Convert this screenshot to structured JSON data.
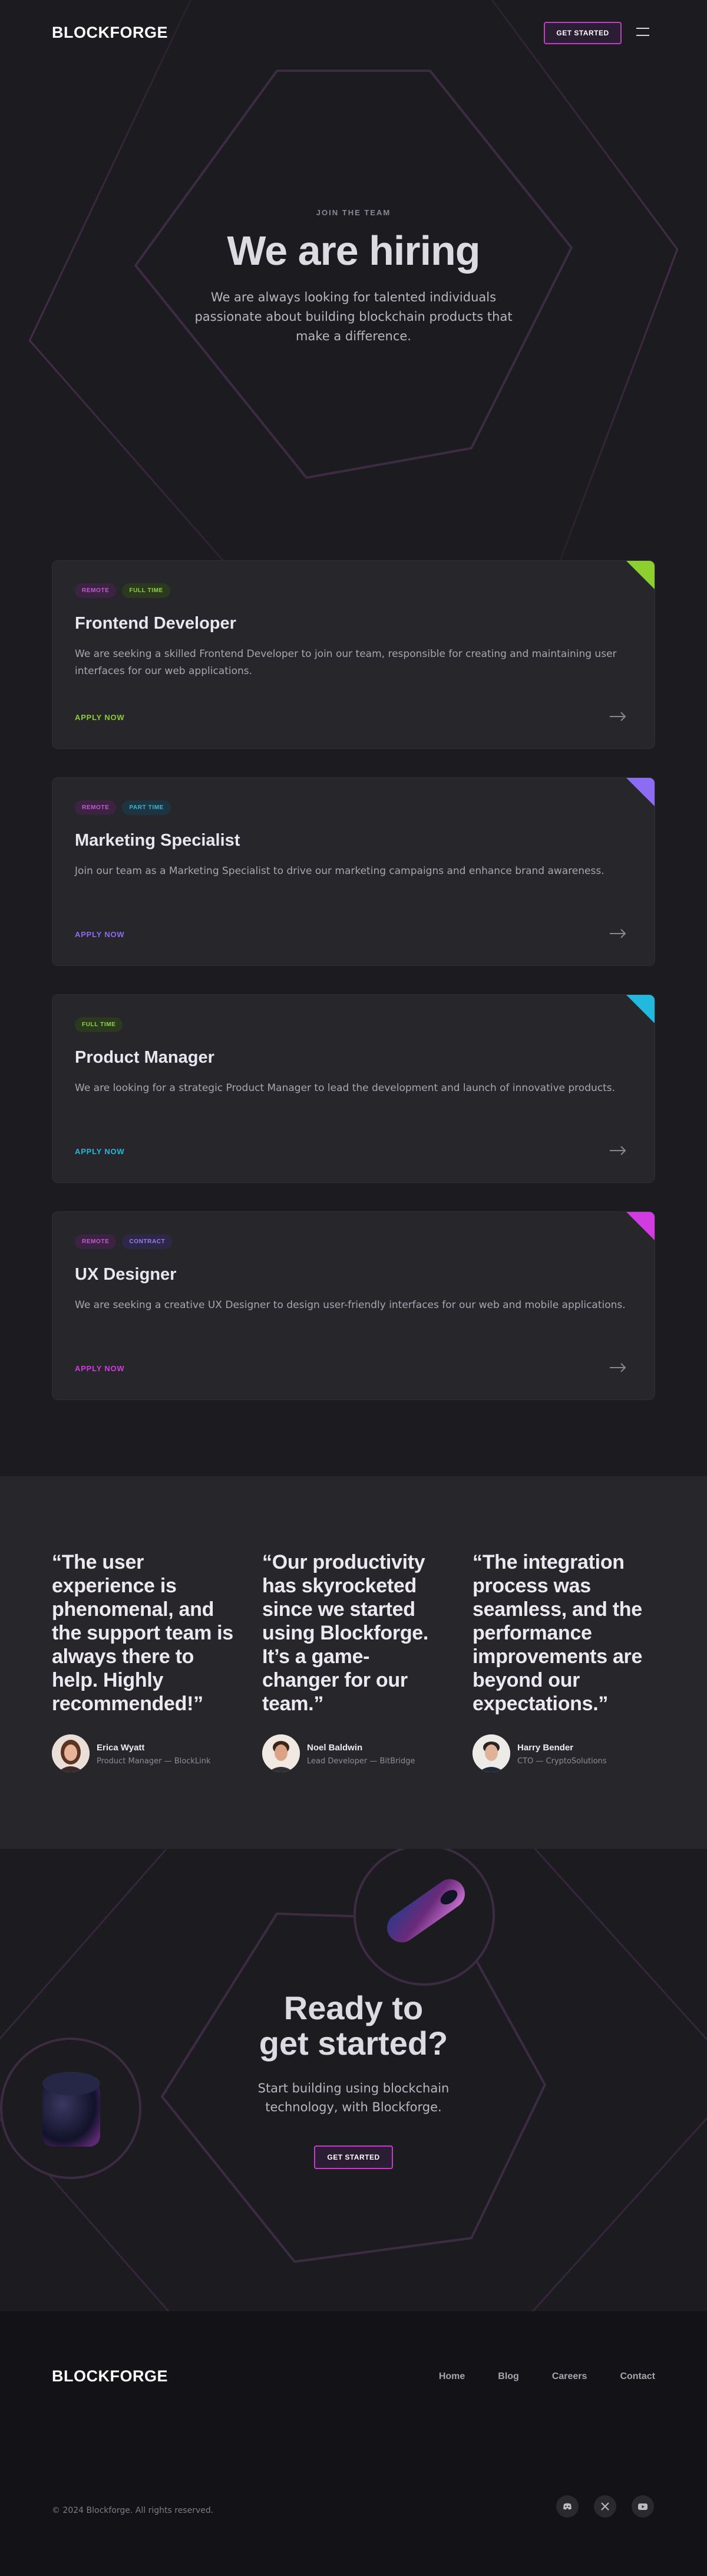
{
  "header": {
    "logo": "BLOCKFORGE",
    "cta_label": "GET STARTED",
    "menu_icon": "hamburger-menu-icon"
  },
  "hero": {
    "eyebrow": "JOIN THE TEAM",
    "title": "We are hiring",
    "subtitle": "We are always looking for talented individuals passionate about building blockchain products that make a difference."
  },
  "jobs": [
    {
      "tags": [
        "REMOTE",
        "FULL TIME"
      ],
      "title": "Frontend Developer",
      "description": "We are seeking a skilled Frontend Developer to join our team, responsible for creating and maintaining user interfaces for our web applications.",
      "apply_label": "APPLY NOW",
      "accent": "#8ccf2f"
    },
    {
      "tags": [
        "REMOTE",
        "PART TIME"
      ],
      "title": "Marketing Specialist",
      "description": "Join our team as a Marketing Specialist to drive our marketing campaigns and enhance brand awareness.",
      "apply_label": "APPLY NOW",
      "accent": "#8b6cf2"
    },
    {
      "tags": [
        "FULL TIME"
      ],
      "title": "Product Manager",
      "description": "We are looking for a strategic Product Manager to lead the development and launch of innovative products.",
      "apply_label": "APPLY NOW",
      "accent": "#23b8dd"
    },
    {
      "tags": [
        "REMOTE",
        "CONTRACT"
      ],
      "title": "UX Designer",
      "description": "We are seeking a creative UX Designer to design user-friendly interfaces for our web and mobile applications.",
      "apply_label": "APPLY NOW",
      "accent": "#d23be0"
    }
  ],
  "testimonials": [
    {
      "quote": "“The user experience is phenomenal, and the support team is always there to help. Highly recommended!”",
      "name": "Erica Wyatt",
      "role": "Product Manager — BlockLink"
    },
    {
      "quote": "“Our productivity has skyrocketed since we started using Blockforge. It’s a game-changer for our team.”",
      "name": "Noel Baldwin",
      "role": "Lead Developer — BitBridge"
    },
    {
      "quote": "“The integration process was seamless, and the performance improvements are beyond our expectations.”",
      "name": "Harry Bender",
      "role": "CTO — CryptoSolutions"
    }
  ],
  "cta": {
    "title_line1": "Ready to",
    "title_line2": "get started?",
    "subtitle": "Start building using blockchain technology, with Blockforge.",
    "button_label": "GET STARTED"
  },
  "footer": {
    "logo": "BLOCKFORGE",
    "nav": [
      "Home",
      "Blog",
      "Careers",
      "Contact"
    ],
    "copyright": "© 2024 Blockforge. All rights reserved.",
    "social_icons": [
      "discord-icon",
      "x-icon",
      "youtube-icon"
    ]
  }
}
